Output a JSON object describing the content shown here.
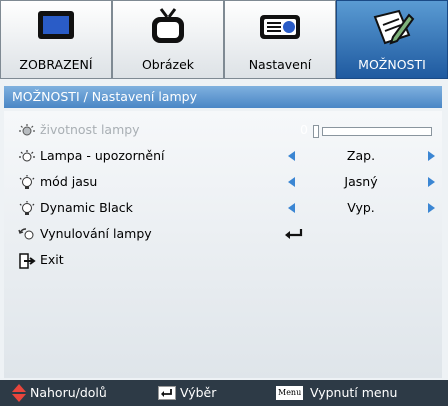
{
  "tabs": [
    {
      "label": "ZOBRAZENÍ",
      "icon": "monitor-icon"
    },
    {
      "label": "Obrázek",
      "icon": "tv-icon"
    },
    {
      "label": "Nastavení",
      "icon": "projector-icon"
    },
    {
      "label": "MOŽNOSTI",
      "icon": "options-pencil-icon"
    }
  ],
  "header": {
    "title": "MOŽNOSTI / Nastavení lampy"
  },
  "menu": {
    "lamp_hours": {
      "label": "životnost lampy",
      "value": "0",
      "level": 0
    },
    "lamp_reminder": {
      "label": "Lampa - upozornění",
      "value": "Zap."
    },
    "brightness_mode": {
      "label": "mód jasu",
      "value": "Jasný"
    },
    "dynamic_black": {
      "label": "Dynamic Black",
      "value": "Vyp."
    },
    "lamp_reset": {
      "label": "Vynulování lampy"
    },
    "exit": {
      "label": "Exit"
    }
  },
  "footer": {
    "updown": "Nahoru/dolů",
    "enter": "Výběr",
    "menu_key": "Menu",
    "menu_action": "Vypnutí menu"
  },
  "colors": {
    "accent": "#3b86d3",
    "active_tab": "#2f6fb5",
    "footer_bg": "#2d3a46"
  }
}
